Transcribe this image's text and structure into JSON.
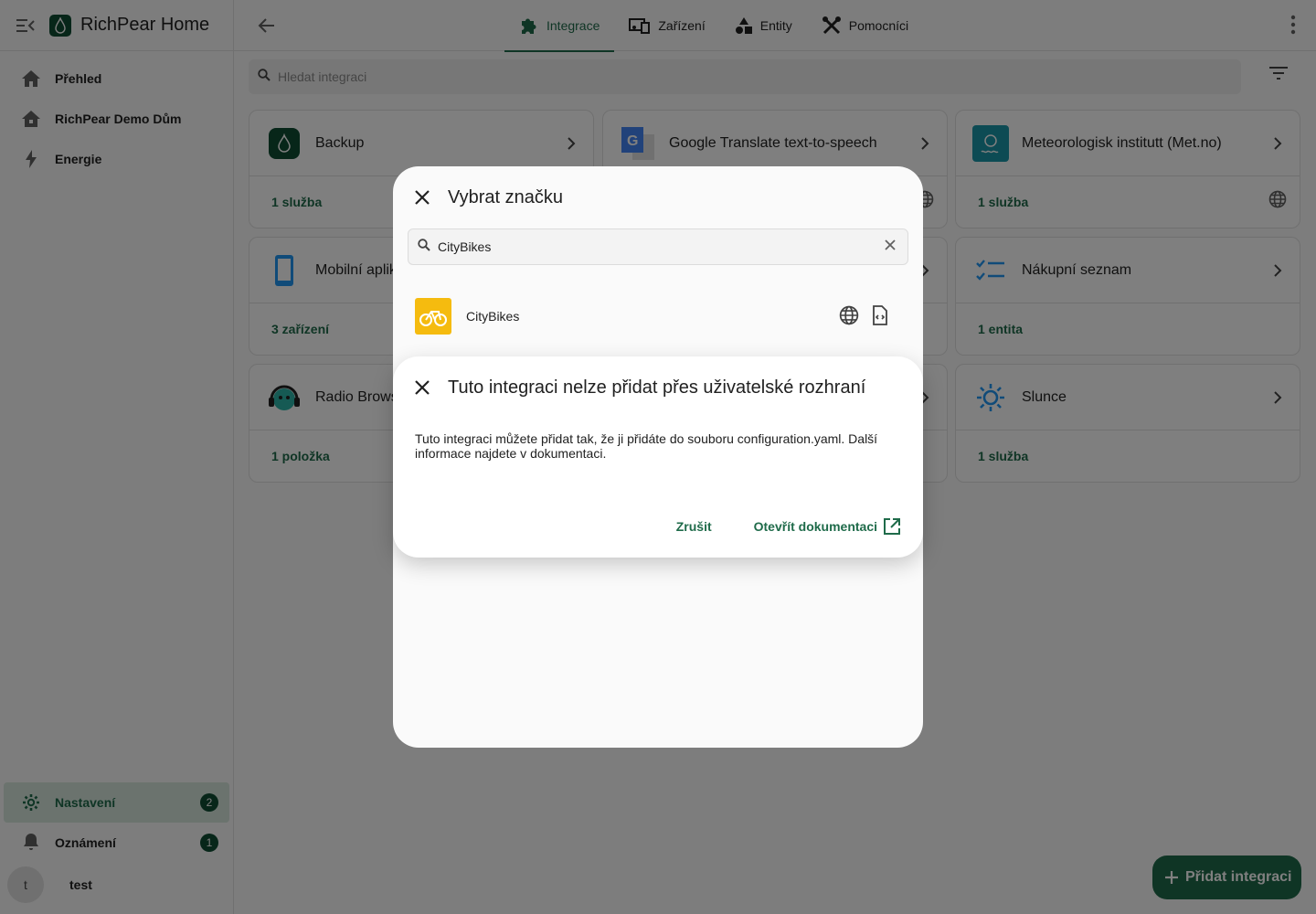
{
  "app": {
    "title": "RichPear Home"
  },
  "sidebar": {
    "items": [
      {
        "label": "Přehled",
        "icon": "home-icon"
      },
      {
        "label": "RichPear Demo Dům",
        "icon": "home-roof-icon"
      },
      {
        "label": "Energie",
        "icon": "lightning-icon"
      }
    ],
    "bottom": [
      {
        "label": "Nastavení",
        "icon": "gear-icon",
        "badge": "2"
      },
      {
        "label": "Oznámení",
        "icon": "bell-icon",
        "badge": "1"
      }
    ],
    "user": {
      "initial": "t",
      "name": "test"
    }
  },
  "tabs": [
    {
      "label": "Integrace",
      "active": true
    },
    {
      "label": "Zařízení"
    },
    {
      "label": "Entity"
    },
    {
      "label": "Pomocníci"
    }
  ],
  "search": {
    "placeholder": "Hledat integraci"
  },
  "cards": [
    {
      "title": "Backup",
      "footer": "1 služba"
    },
    {
      "title": "Google Translate text-to-speech",
      "footer": ""
    },
    {
      "title": "Meteorologisk institutt (Met.no)",
      "footer": "1 služba"
    },
    {
      "title": "Mobilní aplikace",
      "footer": "3 zařízení"
    },
    {
      "title": "",
      "footer": ""
    },
    {
      "title": "Nákupní seznam",
      "footer": "1 entita"
    },
    {
      "title": "Radio Browser",
      "footer": "1 položka"
    },
    {
      "title": "",
      "footer": ""
    },
    {
      "title": "Slunce",
      "footer": "1 služba"
    }
  ],
  "fab": {
    "label": "Přidat integraci"
  },
  "brand_dialog": {
    "title": "Vybrat značku",
    "search_value": "CityBikes",
    "result": {
      "name": "CityBikes"
    }
  },
  "alert_dialog": {
    "title": "Tuto integraci nelze přidat přes uživatelské rozhraní",
    "body": "Tuto integraci můžete přidat tak, že ji přidáte do souboru configuration.yaml. Další informace najdete v dokumentaci.",
    "cancel_label": "Zrušit",
    "open_docs_label": "Otevřít dokumentaci"
  },
  "colors": {
    "accent": "#1f6b4a",
    "brand_dark": "#0e4c33",
    "citybikes": "#f5bb0f"
  }
}
